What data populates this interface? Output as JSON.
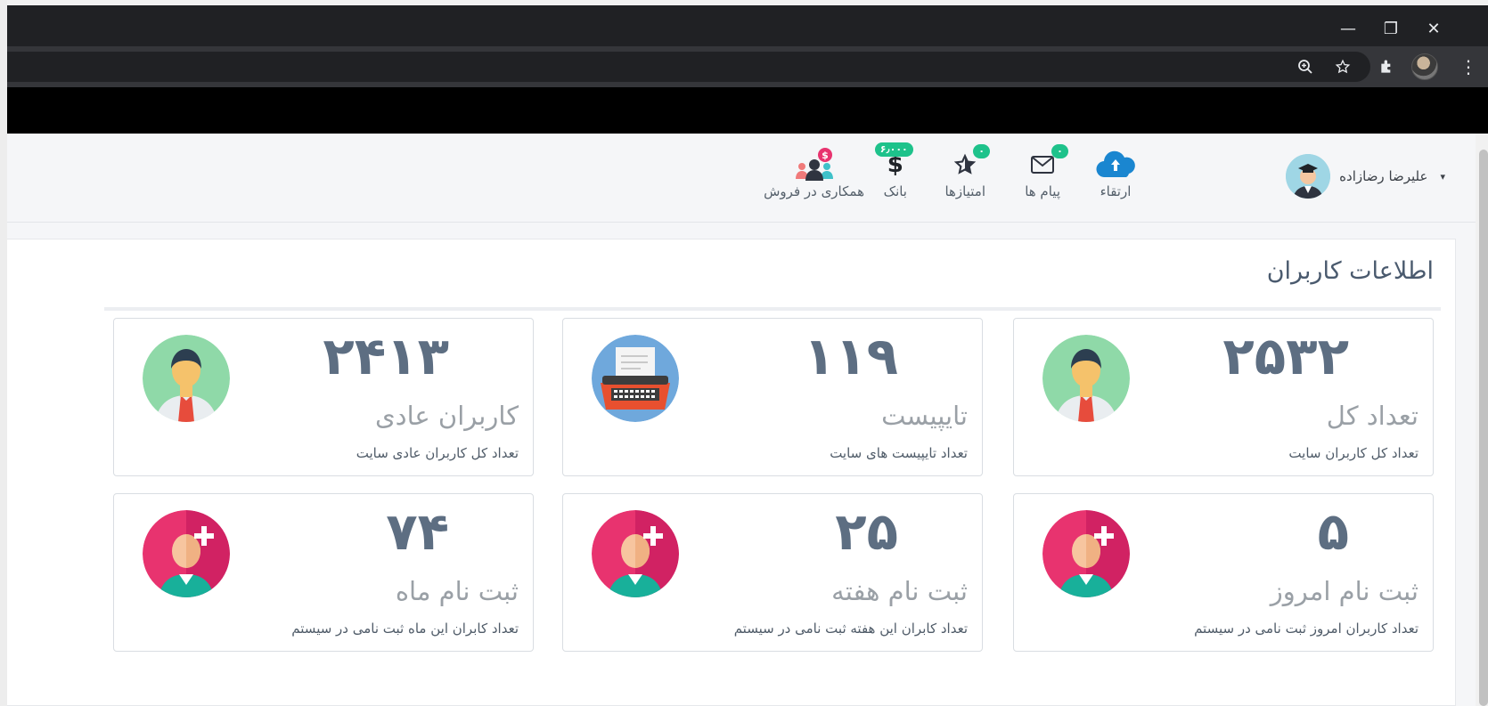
{
  "browser": {
    "window_controls": {
      "minimize": "—",
      "restore": "❐",
      "close": "✕"
    },
    "icons": [
      "zoom-icon",
      "star-icon",
      "extensions-icon",
      "profile-avatar",
      "menu-icon"
    ]
  },
  "header": {
    "user_name": "علیرضا رضازاده",
    "nav": [
      {
        "key": "upgrade",
        "label": "ارتقاء",
        "badge": ""
      },
      {
        "key": "messages",
        "label": "پیام ها",
        "badge": "۰"
      },
      {
        "key": "points",
        "label": "امتیازها",
        "badge": "۰"
      },
      {
        "key": "bank",
        "label": "بانک",
        "badge": "۶٫۰۰۰"
      },
      {
        "key": "sales",
        "label": "همکاری در فروش",
        "badge": "$"
      }
    ]
  },
  "panel": {
    "title": "اطلاعات کاربران",
    "cards": [
      {
        "number": "۲۵۳۲",
        "title": "تعداد کل",
        "desc": "تعداد کل کاربران سایت",
        "icon": "user-icon"
      },
      {
        "number": "۱۱۹",
        "title": "تایپیست",
        "desc": "تعداد تایپیست های سایت",
        "icon": "typewriter-icon"
      },
      {
        "number": "۲۴۱۳",
        "title": "کاربران عادی",
        "desc": "تعداد کل کاربران عادی سایت",
        "icon": "user-icon"
      },
      {
        "number": "۵",
        "title": "ثبت نام امروز",
        "desc": "تعداد کاربران امروز ثبت نامی در سیستم",
        "icon": "add-user-icon"
      },
      {
        "number": "۲۵",
        "title": "ثبت نام هفته",
        "desc": "تعداد کابران این هفته ثبت نامی در سیستم",
        "icon": "add-user-icon"
      },
      {
        "number": "۷۴",
        "title": "ثبت نام ماه",
        "desc": "تعداد کابران این ماه ثبت نامی در سیستم",
        "icon": "add-user-icon"
      }
    ]
  },
  "colors": {
    "accent_badge": "#1ec28b",
    "number": "#5d6e82",
    "pink": "#e8336f"
  }
}
